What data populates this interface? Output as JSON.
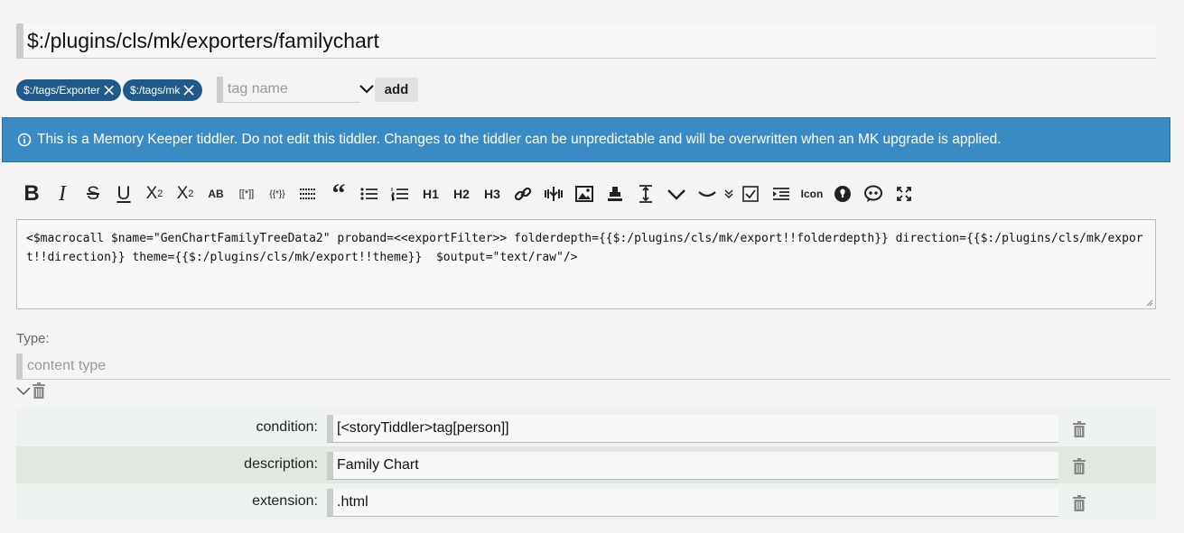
{
  "title": "$:/plugins/cls/mk/exporters/familychart",
  "tags": [
    {
      "label": "$:/tags/Exporter"
    },
    {
      "label": "$:/tags/mk"
    }
  ],
  "tag_input": {
    "placeholder": "tag name"
  },
  "add_button": "add",
  "banner": {
    "text": "This is a Memory Keeper tiddler. Do not edit this tiddler. Changes to the tiddler can be unpredictable and will be overwritten when an MK upgrade is applied."
  },
  "toolbar": {
    "h1": "H1",
    "h2": "H2",
    "h3": "H3",
    "icon_label": "Icon",
    "ab": "AB",
    "wikilink": "[[*]]",
    "transclude": "{{*}}"
  },
  "code": "<$macrocall $name=\"GenChartFamilyTreeData2\" proband=<<exportFilter>> folderdepth={{$:/plugins/cls/mk/export!!folderdepth}} direction={{$:/plugins/cls/mk/export!!direction}} theme={{$:/plugins/cls/mk/export!!theme}}  $output=\"text/raw\"/>",
  "type_section": {
    "label": "Type:",
    "placeholder": "content type"
  },
  "fields": [
    {
      "name": "condition:",
      "value": "[<storyTiddler>tag[person]]"
    },
    {
      "name": "description:",
      "value": "Family Chart"
    },
    {
      "name": "extension:",
      "value": ".html"
    }
  ],
  "colors": {
    "accent": "#3a8ac3",
    "tag": "#1f5a8a",
    "row_a": "#eef2ee",
    "row_b": "#e1e7e1"
  }
}
